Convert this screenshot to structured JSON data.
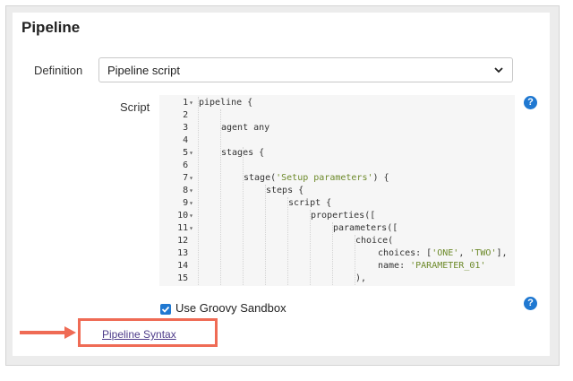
{
  "section": {
    "title": "Pipeline"
  },
  "definition": {
    "label": "Definition",
    "selected": "Pipeline script"
  },
  "script": {
    "label": "Script",
    "lines": [
      {
        "n": "1",
        "fold": true,
        "parts": [
          {
            "t": "pipeline {"
          }
        ],
        "indent": 0
      },
      {
        "n": "2",
        "fold": false,
        "parts": [],
        "indent": 0
      },
      {
        "n": "3",
        "fold": false,
        "parts": [
          {
            "t": "agent any"
          }
        ],
        "indent": 1
      },
      {
        "n": "4",
        "fold": false,
        "parts": [],
        "indent": 0
      },
      {
        "n": "5",
        "fold": true,
        "parts": [
          {
            "t": "stages {"
          }
        ],
        "indent": 1
      },
      {
        "n": "6",
        "fold": false,
        "parts": [],
        "indent": 0
      },
      {
        "n": "7",
        "fold": true,
        "parts": [
          {
            "t": "stage("
          },
          {
            "t": "'Setup parameters'",
            "s": true
          },
          {
            "t": ") {"
          }
        ],
        "indent": 2
      },
      {
        "n": "8",
        "fold": true,
        "parts": [
          {
            "t": "steps {"
          }
        ],
        "indent": 3
      },
      {
        "n": "9",
        "fold": true,
        "parts": [
          {
            "t": "script {"
          }
        ],
        "indent": 4
      },
      {
        "n": "10",
        "fold": true,
        "parts": [
          {
            "t": "properties(["
          }
        ],
        "indent": 5
      },
      {
        "n": "11",
        "fold": true,
        "parts": [
          {
            "t": "parameters(["
          }
        ],
        "indent": 6
      },
      {
        "n": "12",
        "fold": false,
        "parts": [
          {
            "t": "choice("
          }
        ],
        "indent": 7
      },
      {
        "n": "13",
        "fold": false,
        "parts": [
          {
            "t": "choices: ["
          },
          {
            "t": "'ONE'",
            "s": true
          },
          {
            "t": ", "
          },
          {
            "t": "'TWO'",
            "s": true
          },
          {
            "t": "],"
          }
        ],
        "indent": 8
      },
      {
        "n": "14",
        "fold": false,
        "parts": [
          {
            "t": "name: "
          },
          {
            "t": "'PARAMETER_01'",
            "s": true
          }
        ],
        "indent": 8
      },
      {
        "n": "15",
        "fold": false,
        "parts": [
          {
            "t": "),"
          }
        ],
        "indent": 7
      }
    ]
  },
  "sandbox": {
    "label": "Use Groovy Sandbox",
    "checked": true
  },
  "syntax_link": {
    "label": "Pipeline Syntax"
  },
  "icons": {
    "help": "help-icon",
    "select": "chevron-down-icon",
    "arrow": "arrow-right-icon"
  },
  "colors": {
    "accent": "#1f78d1",
    "highlight": "#ef6b55",
    "string": "#6d8a2a",
    "link": "#4e3c8a"
  }
}
